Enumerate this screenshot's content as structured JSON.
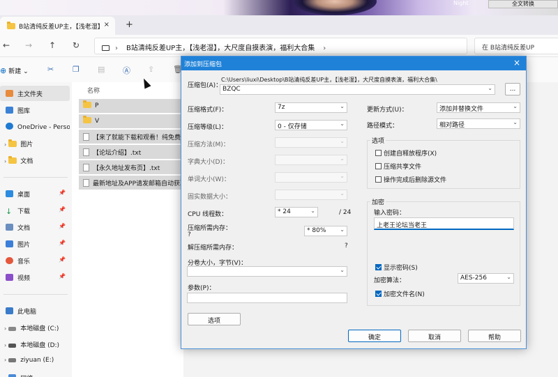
{
  "banner": {
    "badge_text": "Night",
    "button_label": "全文转换"
  },
  "tab": {
    "title": "B站清纯反差UP主，【浅老湿】",
    "close": "×",
    "add": "+"
  },
  "nav": {
    "back": "←",
    "forward": "→",
    "up": "↑",
    "refresh": "↻"
  },
  "address": {
    "chev": "›",
    "path": "B站清纯反差UP主，【浅老湿】，大尺度自摸表演，福利大合集",
    "sep": "›"
  },
  "search": {
    "placeholder": "在 B站清纯反差UP"
  },
  "toolbar": {
    "new_label": "新建",
    "new_chev": "⌄"
  },
  "sidebar": {
    "home": "主文件夹",
    "gallery": "图库",
    "onedrive": "OneDrive - Persor",
    "pictures_cloud": "图片",
    "docs_cloud": "文档",
    "desktop": "桌面",
    "downloads": "下载",
    "documents": "文档",
    "pictures": "图片",
    "music": "音乐",
    "videos": "视频",
    "thispc": "此电脑",
    "drive_c": "本地磁盘 (C:)",
    "drive_d": "本地磁盘 (D:)",
    "drive_e": "ziyuan (E:)",
    "network": "网络"
  },
  "files": {
    "header_name": "名称",
    "rows": [
      "P",
      "V",
      "【来了就能下载和观看！纯免费",
      "【论坛介绍】.txt",
      "【永久地址发布页】.txt",
      "最新地址及APP请发邮箱自动获取"
    ]
  },
  "dialog": {
    "title": "添加到压缩包",
    "close": "×",
    "archive_label": "压缩包(A)：",
    "archive_path": "C:\\Users\\liuxi\\Desktop\\B站清纯反差UP主，【浅老湿】，大尺度自摸表演，福利大合集\\",
    "archive_name": "BZQC",
    "browse": "...",
    "format_label": "压缩格式(F)：",
    "format_value": "7z",
    "level_label": "压缩等级(L)：",
    "level_value": "0 - 仅存储",
    "method_label": "压缩方法(M)：",
    "dict_label": "字典大小(D)：",
    "word_label": "单词大小(W)：",
    "solid_label": "固实数据大小：",
    "cpu_label": "CPU 线程数：",
    "cpu_value": "* 24",
    "cpu_total": "/ 24",
    "mem_label": "压缩所需内存：",
    "mem_q": "?",
    "mem_value": "* 80%",
    "decomp_label": "解压缩所需内存：",
    "decomp_value": "?",
    "split_label": "分卷大小，字节(V)：",
    "params_label": "参数(P)：",
    "options_button": "选项",
    "update_label": "更新方式(U)：",
    "update_value": "添加并替换文件",
    "pathmode_label": "路径模式：",
    "pathmode_value": "相对路径",
    "options_group": "选项",
    "opt_sfx": "创建自释放程序(X)",
    "opt_shared": "压缩共享文件",
    "opt_delete": "操作完成后删除源文件",
    "encrypt_group": "加密",
    "pw_label": "输入密码：",
    "pw_value": "上老王论坛当老王",
    "show_pw": "显示密码(S)",
    "enc_method_label": "加密算法：",
    "enc_method_value": "AES-256",
    "enc_names": "加密文件名(N)",
    "ok": "确定",
    "cancel": "取消",
    "help": "帮助"
  },
  "colors": {
    "title_bar": "#1f82d8",
    "accent": "#0067c0",
    "folder": "#f5c443"
  }
}
